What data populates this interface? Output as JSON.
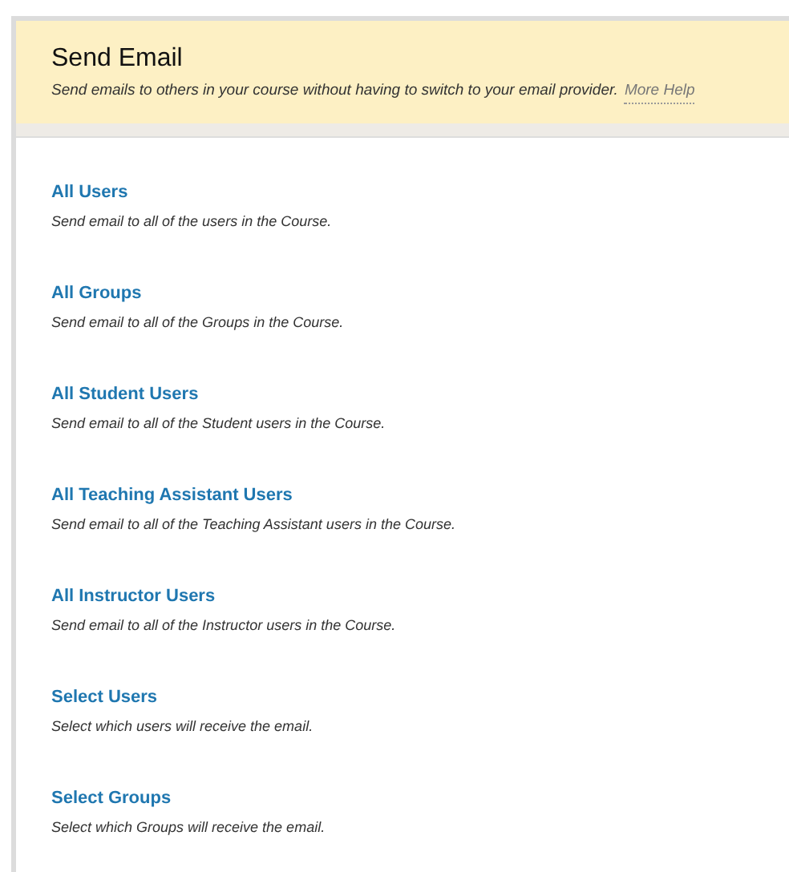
{
  "header": {
    "title": "Send Email",
    "description": "Send emails to others in your course without having to switch to your email provider.",
    "help_link": "More Help"
  },
  "options": [
    {
      "title": "All Users",
      "description": "Send email to all of the users in the Course."
    },
    {
      "title": "All Groups",
      "description": "Send email to all of the Groups in the Course."
    },
    {
      "title": "All Student Users",
      "description": "Send email to all of the Student users in the Course."
    },
    {
      "title": "All Teaching Assistant Users",
      "description": "Send email to all of the Teaching Assistant users in the Course."
    },
    {
      "title": "All Instructor Users",
      "description": "Send email to all of the Instructor users in the Course."
    },
    {
      "title": "Select Users",
      "description": "Select which users will receive the email."
    },
    {
      "title": "Select Groups",
      "description": "Select which Groups will receive the email."
    }
  ]
}
